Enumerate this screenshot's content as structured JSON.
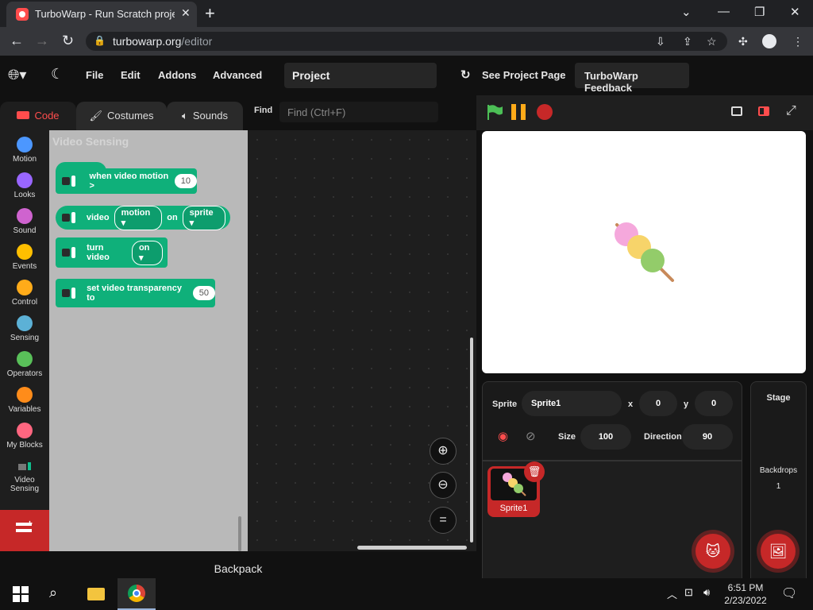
{
  "browser": {
    "tab_title": "TurboWarp - Run Scratch project",
    "url_host": "turbowarp.org",
    "url_path": "/editor"
  },
  "menu": {
    "file": "File",
    "edit": "Edit",
    "addons": "Addons",
    "advanced": "Advanced",
    "project_title": "Project",
    "see_project_page": "See Project Page",
    "feedback": "TurboWarp Feedback"
  },
  "editor_tabs": {
    "code": "Code",
    "costumes": "Costumes",
    "sounds": "Sounds"
  },
  "find": {
    "label": "Find",
    "placeholder": "Find (Ctrl+F)"
  },
  "categories": [
    {
      "label": "Motion",
      "color": "#4c97ff"
    },
    {
      "label": "Looks",
      "color": "#9966ff"
    },
    {
      "label": "Sound",
      "color": "#cf63cf"
    },
    {
      "label": "Events",
      "color": "#ffbf00"
    },
    {
      "label": "Control",
      "color": "#ffab19"
    },
    {
      "label": "Sensing",
      "color": "#5cb1d6"
    },
    {
      "label": "Operators",
      "color": "#59c059"
    },
    {
      "label": "Variables",
      "color": "#ff8c1a"
    },
    {
      "label": "My Blocks",
      "color": "#ff6680"
    },
    {
      "label": "Video Sensing",
      "color": "#0fbd8c"
    }
  ],
  "flyout": {
    "heading": "Video Sensing",
    "block1": {
      "text": "when video motion >",
      "value": "10"
    },
    "block2": {
      "text1": "video",
      "dd1": "motion",
      "text2": "on",
      "dd2": "sprite"
    },
    "block3": {
      "text": "turn video",
      "dd": "on"
    },
    "block4": {
      "text": "set video transparency to",
      "value": "50"
    }
  },
  "backpack": "Backpack",
  "sprite_info": {
    "sprite_label": "Sprite",
    "sprite_name": "Sprite1",
    "x_label": "x",
    "x": "0",
    "y_label": "y",
    "y": "0",
    "size_label": "Size",
    "size": "100",
    "direction_label": "Direction",
    "direction": "90"
  },
  "sprite_list": [
    {
      "name": "Sprite1"
    }
  ],
  "stage_panel": {
    "title": "Stage",
    "backdrops_label": "Backdrops",
    "backdrops_count": "1"
  },
  "taskbar": {
    "time": "6:51 PM",
    "date": "2/23/2022"
  },
  "colors": {
    "accent": "#c62828",
    "block_green": "#0fb07a"
  }
}
